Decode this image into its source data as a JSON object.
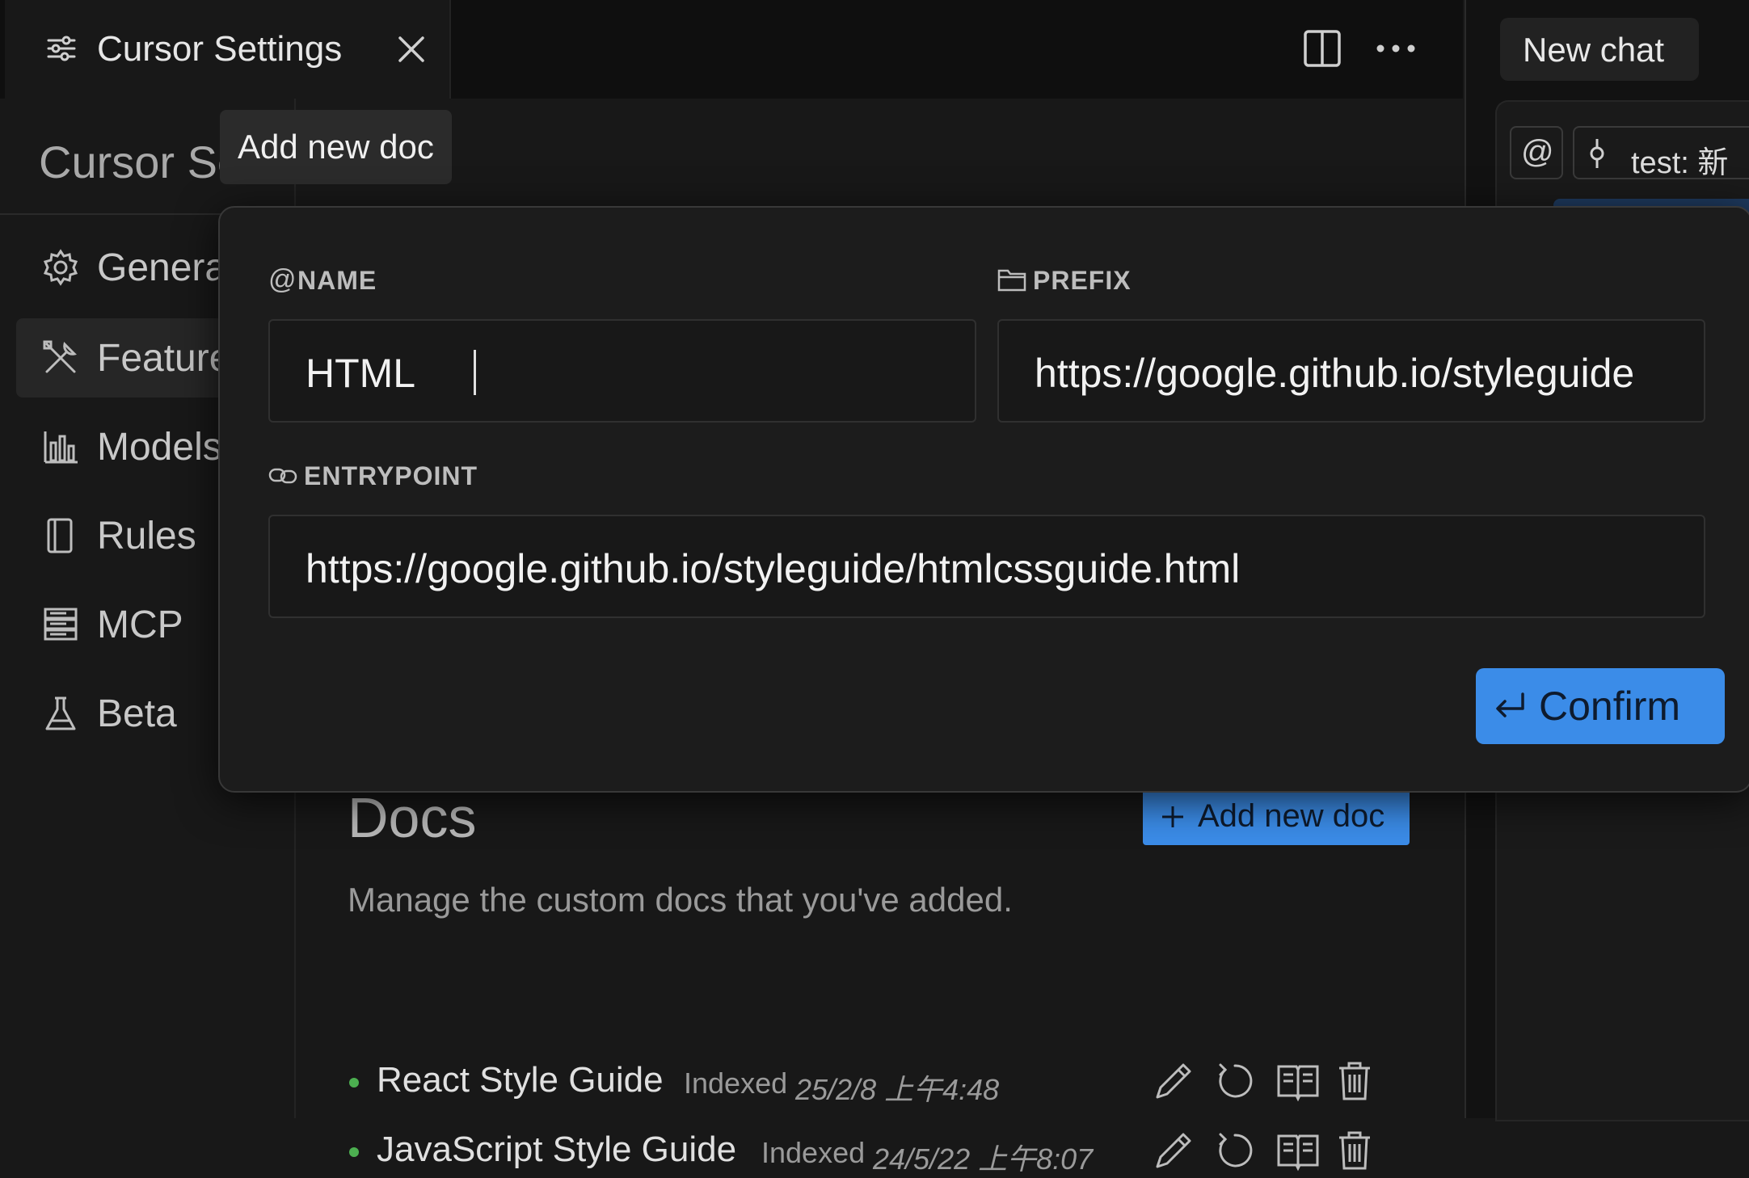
{
  "tab": {
    "title": "Cursor Settings"
  },
  "settings": {
    "heading": "Cursor Settings",
    "nav": [
      {
        "label": "General",
        "icon": "gear-icon"
      },
      {
        "label": "Features",
        "icon": "tools-icon"
      },
      {
        "label": "Models",
        "icon": "bar-chart-icon"
      },
      {
        "label": "Rules",
        "icon": "document-icon"
      },
      {
        "label": "MCP",
        "icon": "server-icon"
      },
      {
        "label": "Beta",
        "icon": "flask-icon"
      }
    ]
  },
  "chat": {
    "new_chat_label": "New chat",
    "context_label": "test: 新"
  },
  "tooltip": {
    "text": "Add new doc"
  },
  "dialog": {
    "name_label": "NAME",
    "name_value": "HTML",
    "prefix_label": "PREFIX",
    "prefix_value": "https://google.github.io/styleguide",
    "entrypoint_label": "ENTRYPOINT",
    "entrypoint_value": "https://google.github.io/styleguide/htmlcssguide.html",
    "confirm_label": "Confirm"
  },
  "docs": {
    "title": "Docs",
    "description": "Manage the custom docs that you've added.",
    "add_label": "Add new doc",
    "items": [
      {
        "name": "React Style Guide",
        "indexed_label": "Indexed",
        "date": "25/2/8 上午4:48"
      },
      {
        "name": "JavaScript Style Guide",
        "indexed_label": "Indexed",
        "date": "24/5/22 上午8:07"
      }
    ]
  },
  "colors": {
    "accent": "#3b8ce8",
    "status_dot": "#4caf50",
    "background": "#181818"
  }
}
